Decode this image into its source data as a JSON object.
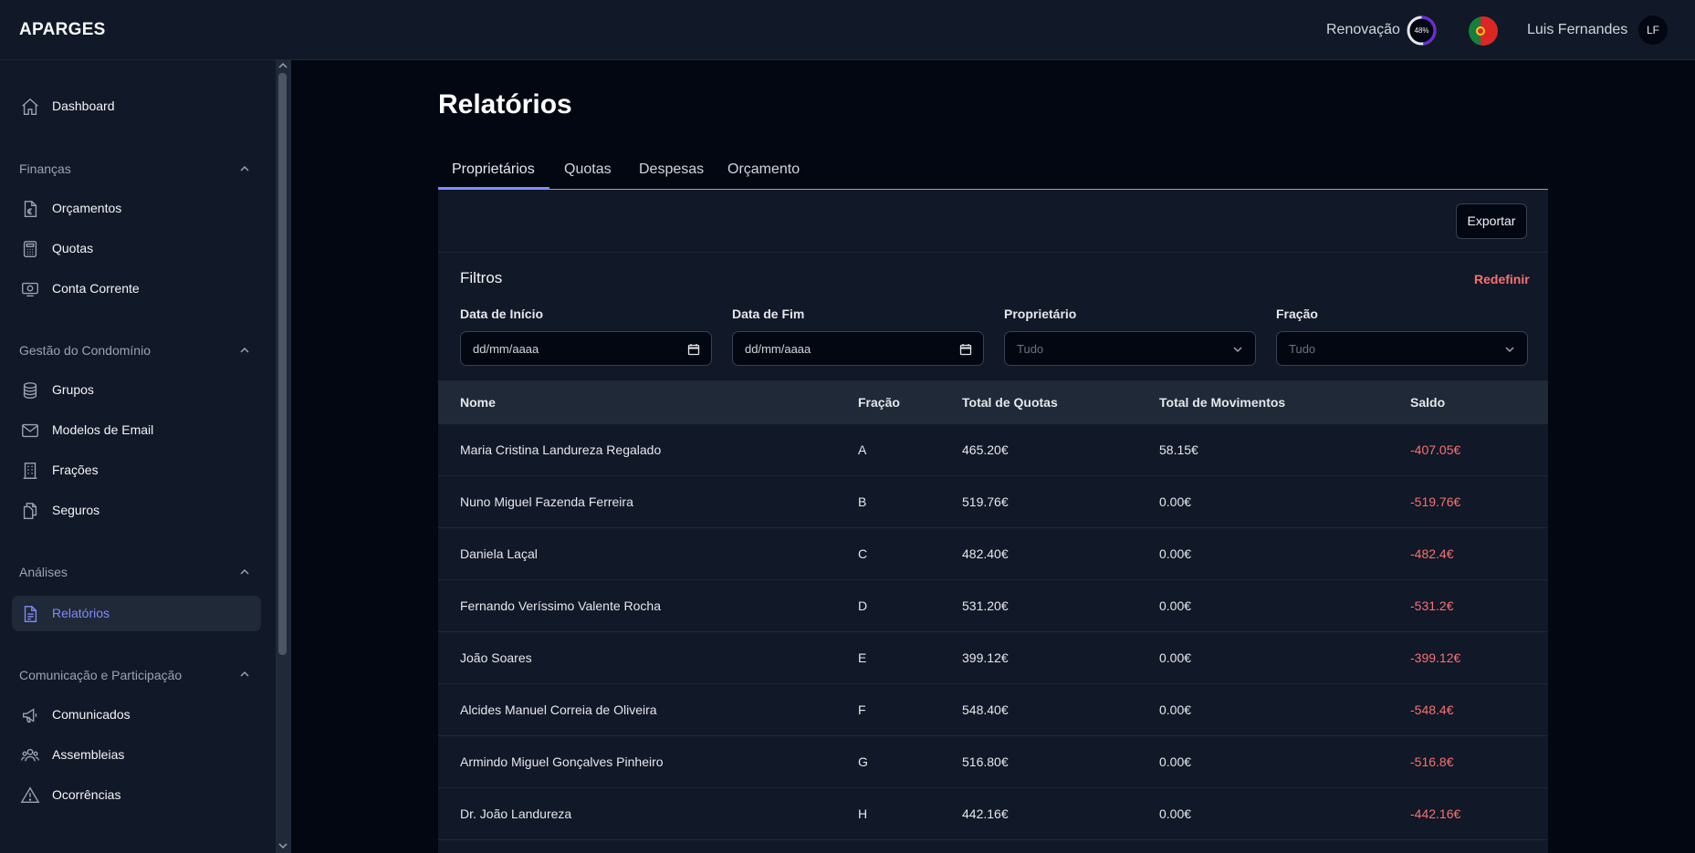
{
  "app": {
    "brand": "APARGES",
    "renewal_label": "Renovação",
    "renewal_progress_text": "48%",
    "renewal_progress": 0.48,
    "user_name": "Luis Fernandes",
    "user_initials": "LF"
  },
  "sidebar": {
    "dashboard": "Dashboard",
    "sections": {
      "financas": "Finanças",
      "gestao": "Gestão do Condomínio",
      "analises": "Análises",
      "comunicacao": "Comunicação e Participação"
    },
    "items": {
      "orcamentos": "Orçamentos",
      "quotas": "Quotas",
      "conta_corrente": "Conta Corrente",
      "grupos": "Grupos",
      "modelos_email": "Modelos de Email",
      "fracoes": "Frações",
      "seguros": "Seguros",
      "relatorios": "Relatórios",
      "comunicados": "Comunicados",
      "assembleias": "Assembleias",
      "ocorrencias": "Ocorrências"
    }
  },
  "main": {
    "title": "Relatórios",
    "tabs": [
      "Proprietários",
      "Quotas",
      "Despesas",
      "Orçamento"
    ],
    "export_label": "Exportar",
    "filters": {
      "title": "Filtros",
      "reset_label": "Redefinir",
      "start_date_label": "Data de Início",
      "start_date_value": "dd/mm/aaaa",
      "end_date_label": "Data de Fim",
      "end_date_value": "dd/mm/aaaa",
      "owner_label": "Proprietário",
      "owner_value": "Tudo",
      "fraction_label": "Fração",
      "fraction_value": "Tudo"
    },
    "table": {
      "headers": [
        "Nome",
        "Fração",
        "Total de Quotas",
        "Total de Movimentos",
        "Saldo"
      ],
      "rows": [
        [
          "Maria Cristina Landureza Regalado",
          "A",
          "465.20€",
          "58.15€",
          "-407.05€"
        ],
        [
          "Nuno Miguel Fazenda Ferreira",
          "B",
          "519.76€",
          "0.00€",
          "-519.76€"
        ],
        [
          "Daniela Laçal",
          "C",
          "482.40€",
          "0.00€",
          "-482.4€"
        ],
        [
          "Fernando Veríssimo Valente Rocha",
          "D",
          "531.20€",
          "0.00€",
          "-531.2€"
        ],
        [
          "João Soares",
          "E",
          "399.12€",
          "0.00€",
          "-399.12€"
        ],
        [
          "Alcides Manuel Correia de Oliveira",
          "F",
          "548.40€",
          "0.00€",
          "-548.4€"
        ],
        [
          "Armindo Miguel Gonçalves Pinheiro",
          "G",
          "516.80€",
          "0.00€",
          "-516.8€"
        ],
        [
          "Dr. João Landureza",
          "H",
          "442.16€",
          "0.00€",
          "-442.16€"
        ]
      ]
    }
  },
  "colors": {
    "accent": "#818cf8",
    "negative": "#f87171",
    "panel": "#111827",
    "background": "#030712"
  }
}
